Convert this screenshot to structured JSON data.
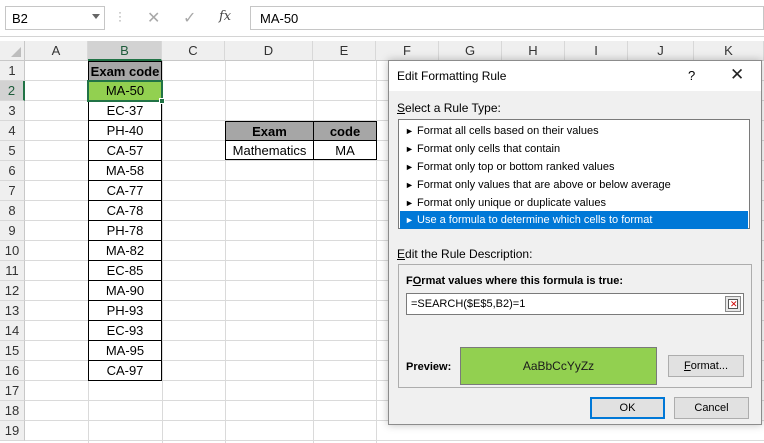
{
  "formula_bar": {
    "name_box": "B2",
    "cancel_symbol": "✕",
    "enter_symbol": "✓",
    "fx_symbol": "fx",
    "formula": "MA-50"
  },
  "sheet": {
    "columns": [
      "A",
      "B",
      "C",
      "D",
      "E",
      "F",
      "G",
      "H",
      "I",
      "J",
      "K"
    ],
    "rows": [
      "1",
      "2",
      "3",
      "4",
      "5",
      "6",
      "7",
      "8",
      "9",
      "10",
      "11",
      "12",
      "13",
      "14",
      "15",
      "16",
      "17",
      "18",
      "19"
    ],
    "selected_cell": "B2",
    "exam_codes": {
      "header": "Exam code",
      "values": [
        "MA-50",
        "EC-37",
        "PH-40",
        "CA-57",
        "MA-58",
        "CA-77",
        "CA-78",
        "PH-78",
        "MA-82",
        "EC-85",
        "MA-90",
        "PH-93",
        "EC-93",
        "MA-95",
        "CA-97"
      ]
    },
    "lookup_table": {
      "headers": [
        "Exam",
        "code"
      ],
      "row": [
        "Mathematics",
        "MA"
      ]
    },
    "highlight_color": "#92d050",
    "header_fill": "#a6a6a6"
  },
  "dialog": {
    "title": "Edit Formatting Rule",
    "help": "?",
    "close": "✕",
    "select_rule_label_u": "S",
    "select_rule_label_rest": "elect a Rule Type:",
    "rule_types": [
      "Format all cells based on their values",
      "Format only cells that contain",
      "Format only top or bottom ranked values",
      "Format only values that are above or below average",
      "Format only unique or duplicate values",
      "Use a formula to determine which cells to format"
    ],
    "selected_rule_index": 5,
    "edit_desc_label_u": "E",
    "edit_desc_label_rest": "dit the Rule Description:",
    "formula_label_u": "O",
    "formula_label_pre": "F",
    "formula_label_rest": "rmat values where this formula is true:",
    "formula_value": "=SEARCH($E$5,B2)=1",
    "preview_label": "Preview:",
    "preview_text": "AaBbCcYyZz",
    "format_button_u": "F",
    "format_button_rest": "ormat...",
    "ok_label": "OK",
    "cancel_label": "Cancel",
    "accent_color": "#0078d7"
  }
}
